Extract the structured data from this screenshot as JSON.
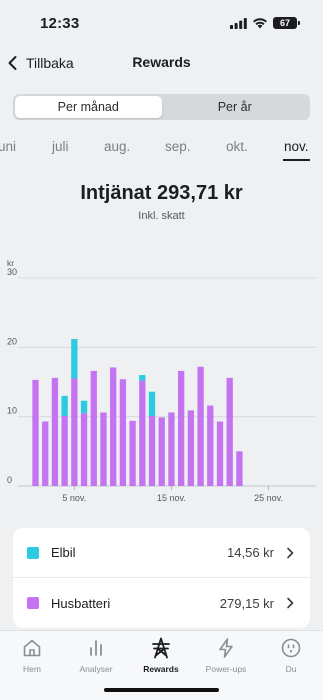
{
  "status_bar": {
    "time": "12:33",
    "battery": "67"
  },
  "header": {
    "back_label": "Tillbaka",
    "title": "Rewards"
  },
  "segmented": {
    "options": [
      "Per månad",
      "Per år"
    ],
    "selected": "Per månad"
  },
  "months": [
    "uni",
    "juli",
    "aug.",
    "sep.",
    "okt.",
    "nov."
  ],
  "selected_month": "nov.",
  "summary": {
    "title": "Intjänat 293,71 kr",
    "subtitle": "Inkl. skatt"
  },
  "chart_data": {
    "type": "bar",
    "stacked": true,
    "unit_label": "kr",
    "ylim": [
      0,
      30
    ],
    "yticks": [
      0,
      10,
      20,
      30
    ],
    "x": [
      1,
      2,
      3,
      4,
      5,
      6,
      7,
      8,
      9,
      10,
      11,
      12,
      13,
      14,
      15,
      16,
      17,
      18,
      19,
      20,
      21,
      22,
      23,
      24,
      25,
      26,
      27,
      28,
      29,
      30
    ],
    "xticks": [
      {
        "day": 5,
        "label": "5 nov."
      },
      {
        "day": 15,
        "label": "15 nov."
      },
      {
        "day": 25,
        "label": "25 nov."
      }
    ],
    "series": [
      {
        "name": "Husbatteri",
        "color": "#c474f0",
        "values": [
          15.3,
          9.3,
          15.6,
          10.1,
          15.5,
          10.5,
          16.6,
          10.6,
          17.1,
          15.4,
          9.4,
          15.2,
          10.1,
          9.9,
          10.6,
          16.6,
          10.9,
          17.2,
          11.6,
          9.3,
          15.6,
          5.0,
          0,
          0,
          0,
          0,
          0,
          0,
          0,
          0
        ]
      },
      {
        "name": "Elbil",
        "color": "#2ccbe2",
        "values": [
          0,
          0,
          0,
          2.9,
          5.7,
          1.8,
          0,
          0,
          0,
          0,
          0,
          0.8,
          3.5,
          0,
          0,
          0,
          0,
          0,
          0,
          0,
          0,
          0,
          0,
          0,
          0,
          0,
          0,
          0,
          0,
          0
        ]
      }
    ]
  },
  "legend": [
    {
      "name": "Elbil",
      "value": "14,56 kr",
      "color": "#2ccbe2"
    },
    {
      "name": "Husbatteri",
      "value": "279,15 kr",
      "color": "#c474f0"
    }
  ],
  "tabs": [
    {
      "label": "Hem",
      "icon": "home-icon"
    },
    {
      "label": "Analyser",
      "icon": "bar-chart-icon"
    },
    {
      "label": "Rewards",
      "icon": "pylon-icon"
    },
    {
      "label": "Power-ups",
      "icon": "lightning-icon"
    },
    {
      "label": "Du",
      "icon": "plug-face-icon"
    }
  ],
  "active_tab": "Rewards"
}
